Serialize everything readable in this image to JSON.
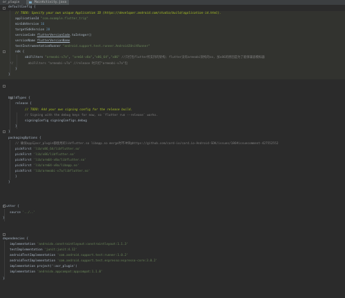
{
  "tabs": [
    {
      "label": "or_plugin",
      "active": false
    },
    {
      "label": "MainActivity.java",
      "active": true
    }
  ],
  "code": [
    {
      "segs": [
        {
          "t": "defaultConfig {",
          "c": ""
        }
      ]
    },
    {
      "segs": [
        {
          "t": "// TODO: Specify your own unique Application ID (https://developer.android.com/studio/build/application-id.html).",
          "c": "todo"
        }
      ]
    },
    {
      "segs": [
        {
          "t": "applicationId ",
          "c": ""
        },
        {
          "t": "\"com.example.flutter_trip\"",
          "c": "str"
        }
      ]
    },
    {
      "segs": [
        {
          "t": "minSdkVersion ",
          "c": ""
        },
        {
          "t": "16",
          "c": "num"
        }
      ]
    },
    {
      "segs": [
        {
          "t": "targetSdkVersion ",
          "c": ""
        },
        {
          "t": "28",
          "c": "num"
        }
      ]
    },
    {
      "segs": [
        {
          "t": "versionCode ",
          "c": ""
        },
        {
          "t": "flutterVersionCode",
          "c": "ident"
        },
        {
          "t": ".toInteger()",
          "c": ""
        }
      ]
    },
    {
      "segs": [
        {
          "t": "versionName ",
          "c": ""
        },
        {
          "t": "flutterVersionName",
          "c": "ident"
        }
      ]
    },
    {
      "segs": [
        {
          "t": "testInstrumentationRunner ",
          "c": ""
        },
        {
          "t": "\"android.support.test.runner.AndroidJUnitRunner\"",
          "c": "str"
        }
      ]
    },
    {
      "segs": [
        {
          "t": "ndk {",
          "c": ""
        }
      ]
    },
    {
      "segs": [
        {
          "t": "abiFilters ",
          "c": ""
        },
        {
          "t": "\"armeabi-v7a\"",
          "c": "str"
        },
        {
          "t": ", ",
          "c": ""
        },
        {
          "t": "\"arm64-v8a\"",
          "c": "str"
        },
        {
          "t": ",",
          "c": ""
        },
        {
          "t": "\"x86_64\"",
          "c": "str"
        },
        {
          "t": ",",
          "c": ""
        },
        {
          "t": "\"x86\"",
          "c": "str"
        },
        {
          "t": " //只打包flutter所支持的架构; flutter没有armeabi架构的so, 加x86的原因是为了能够兼容模拟器",
          "c": "comment"
        }
      ]
    },
    {
      "segs": [
        {
          "t": "//",
          "c": "comment"
        },
        {
          "t": "        abiFilters \"armeabi-v7a\" //release 时只打\"armeabi-v7a\"包",
          "c": "comment"
        }
      ]
    },
    {
      "segs": [
        {
          "t": "}",
          "c": ""
        }
      ]
    },
    {
      "segs": [
        {
          "t": "}",
          "c": ""
        }
      ]
    },
    {
      "segs": []
    },
    {
      "segs": [
        {
          "t": "buildTypes {",
          "c": ""
        }
      ]
    },
    {
      "segs": [
        {
          "t": "release {",
          "c": ""
        }
      ]
    },
    {
      "segs": [
        {
          "t": "// TODO: Add your own signing config for the release build.",
          "c": "todo"
        }
      ]
    },
    {
      "segs": [
        {
          "t": "// Signing with the debug keys for now, so `flutter run --release` works.",
          "c": "comment"
        }
      ]
    },
    {
      "segs": [
        {
          "t": "signingConfig ",
          "c": ""
        },
        {
          "t": "signingConfigs",
          "c": ""
        },
        {
          "t": ".debug",
          "c": ""
        }
      ]
    },
    {
      "segs": [
        {
          "t": "}",
          "c": ""
        }
      ]
    },
    {
      "segs": [
        {
          "t": "}",
          "c": ""
        }
      ]
    },
    {
      "segs": [
        {
          "t": "packagingOptions {",
          "c": ""
        }
      ]
    },
    {
      "segs": [
        {
          "t": "// 确保app与asr_plugin都使用的libflutter.so libapp.so merge时不冲突@https://github.com/card-io/card.io-Android-SDK/issues/186#issuecomment-427552552",
          "c": "comment"
        }
      ]
    },
    {
      "segs": [
        {
          "t": "pickFirst ",
          "c": ""
        },
        {
          "t": "'lib/x86_64/libflutter.so'",
          "c": "str"
        }
      ]
    },
    {
      "segs": [
        {
          "t": "pickFirst ",
          "c": ""
        },
        {
          "t": "'lib/x86/libflutter.so'",
          "c": "str"
        }
      ]
    },
    {
      "segs": [
        {
          "t": "pickFirst ",
          "c": ""
        },
        {
          "t": "'lib/arm64-v8a/libflutter.so'",
          "c": "str"
        }
      ]
    },
    {
      "segs": [
        {
          "t": "pickFirst ",
          "c": ""
        },
        {
          "t": "'lib/arm64-v8a/libapp.so'",
          "c": "str"
        }
      ]
    },
    {
      "segs": [
        {
          "t": "pickFirst ",
          "c": ""
        },
        {
          "t": "'lib/armeabi-v7a/libflutter.so'",
          "c": "str"
        }
      ]
    },
    {
      "segs": [
        {
          "t": "}",
          "c": ""
        }
      ]
    },
    {
      "segs": [
        {
          "t": "}",
          "c": ""
        }
      ]
    },
    {
      "segs": []
    },
    {
      "segs": [
        {
          "t": "flutter {",
          "c": ""
        }
      ]
    },
    {
      "segs": [
        {
          "t": "source ",
          "c": ""
        },
        {
          "t": "'../..'",
          "c": "str"
        }
      ]
    },
    {
      "segs": [
        {
          "t": "}",
          "c": ""
        }
      ]
    },
    {
      "segs": []
    },
    {
      "segs": [
        {
          "t": "dependencies {",
          "c": ""
        }
      ]
    },
    {
      "segs": [
        {
          "t": "implementation ",
          "c": ""
        },
        {
          "t": "'androidx.constraintlayout:constraintlayout:1.1.3'",
          "c": "str"
        }
      ]
    },
    {
      "segs": [
        {
          "t": "testImplementation ",
          "c": ""
        },
        {
          "t": "'junit:junit:4.12'",
          "c": "str"
        }
      ]
    },
    {
      "segs": [
        {
          "t": "androidTestImplementation ",
          "c": ""
        },
        {
          "t": "'com.android.support.test:runner:1.0.2'",
          "c": "str"
        }
      ]
    },
    {
      "segs": [
        {
          "t": "androidTestImplementation ",
          "c": ""
        },
        {
          "t": "'com.android.support.test.espresso:espresso-core:3.0.2'",
          "c": "str"
        }
      ]
    },
    {
      "segs": [
        {
          "t": "implementation ",
          "c": ""
        },
        {
          "t": "project(':asr_plugin')",
          "c": ""
        }
      ]
    },
    {
      "segs": [
        {
          "t": "implementation ",
          "c": ""
        },
        {
          "t": "'androidx.appcompat:appcompat:1.1.0'",
          "c": "str"
        }
      ]
    },
    {
      "segs": [
        {
          "t": "}",
          "c": ""
        }
      ]
    }
  ]
}
